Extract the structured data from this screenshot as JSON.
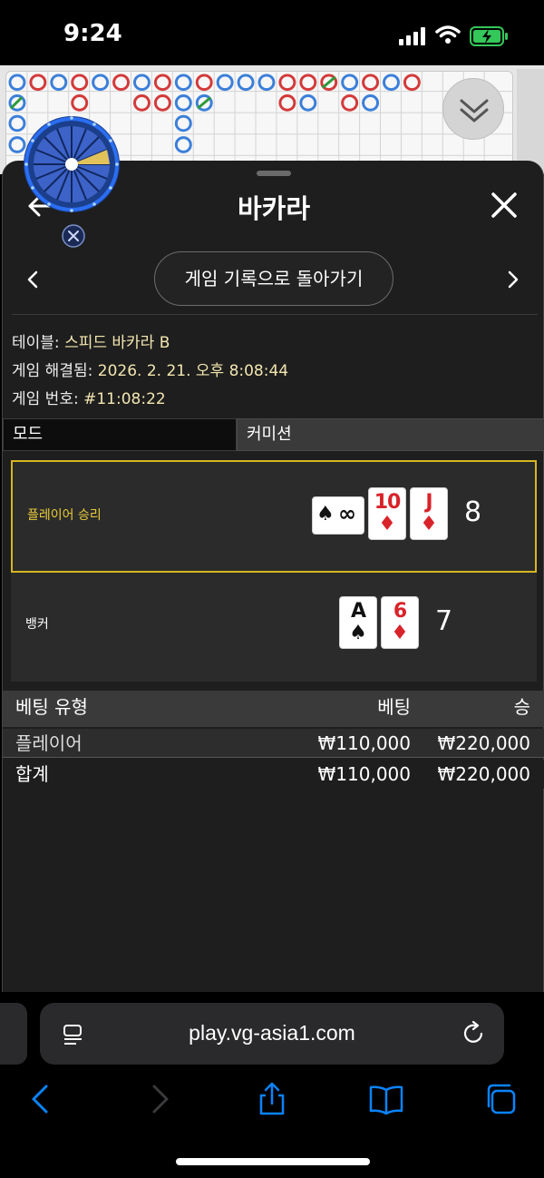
{
  "status_bar": {
    "time": "9:24"
  },
  "sheet": {
    "title": "바카라",
    "history_button": "게임 기록으로 돌아가기"
  },
  "info": {
    "table_label": "테이블:",
    "table_value": "스피드 바카라 B",
    "resolved_label": "게임 해결됨:",
    "resolved_value": "2026. 2. 21. 오후 8:08:44",
    "game_no_label": "게임 번호:",
    "game_no_value": "#11:08:22"
  },
  "mode": {
    "left": "모드",
    "right": "커미션"
  },
  "results": {
    "player": {
      "label": "플레이어 승리",
      "score": "8",
      "cards": [
        {
          "rank": "∞",
          "suit": "♠",
          "color": "black",
          "orientation": "horizontal"
        },
        {
          "rank": "10",
          "suit": "♦",
          "color": "red"
        },
        {
          "rank": "J",
          "suit": "♦",
          "color": "red"
        }
      ]
    },
    "banker": {
      "label": "뱅커",
      "score": "7",
      "cards": [
        {
          "rank": "A",
          "suit": "♠",
          "color": "black"
        },
        {
          "rank": "6",
          "suit": "♦",
          "color": "red"
        }
      ]
    }
  },
  "bets": {
    "headers": {
      "type": "베팅 유형",
      "bet": "베팅",
      "win": "승"
    },
    "rows": [
      {
        "type": "플레이어",
        "bet": "₩110,000",
        "win": "₩220,000"
      },
      {
        "type": "합계",
        "bet": "₩110,000",
        "win": "₩220,000"
      }
    ]
  },
  "browser": {
    "url": "play.vg-asia1.com"
  },
  "colors": {
    "accent_gold": "#d6b621",
    "player_label": "#e9cb3a",
    "info_value": "#f2e6b0",
    "card_red": "#d8232a",
    "ios_blue": "#0a84ff",
    "battery_green": "#34c759"
  },
  "icons": {
    "back": "back-arrow-icon",
    "close": "close-icon",
    "prev": "chevron-left-icon",
    "next": "chevron-right-icon",
    "reader": "reader-mode-icon",
    "reload": "reload-icon",
    "toolbar": [
      "back-icon",
      "forward-icon",
      "share-icon",
      "bookmarks-icon",
      "tabs-icon"
    ]
  }
}
